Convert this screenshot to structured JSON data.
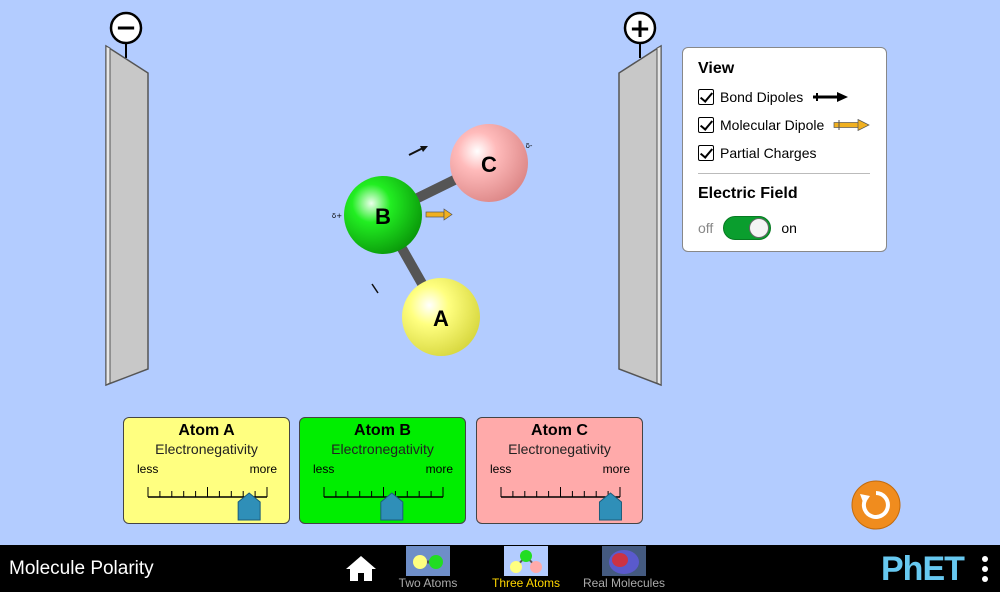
{
  "app": {
    "title": "Molecule Polarity"
  },
  "plates": {
    "negative_symbol": "−",
    "positive_symbol": "+"
  },
  "molecule": {
    "atoms": [
      {
        "label": "A",
        "color": "#ffff80"
      },
      {
        "label": "B",
        "color": "#22dd22"
      },
      {
        "label": "C",
        "color": "#ffaaaa"
      }
    ],
    "partial_charge_b": "δ+",
    "partial_charge_c": "δ-"
  },
  "view_panel": {
    "title": "View",
    "options": [
      {
        "label": "Bond Dipoles",
        "checked": true
      },
      {
        "label": "Molecular Dipole",
        "checked": true
      },
      {
        "label": "Partial Charges",
        "checked": true
      }
    ],
    "electric_field": {
      "title": "Electric Field",
      "off_label": "off",
      "on_label": "on",
      "state": "on"
    }
  },
  "atom_panels": [
    {
      "title": "Atom A",
      "subtitle": "Electronegativity",
      "less": "less",
      "more": "more",
      "bg": "#ffff80",
      "value_fraction": 0.85
    },
    {
      "title": "Atom B",
      "subtitle": "Electronegativity",
      "less": "less",
      "more": "more",
      "bg": "#00ee00",
      "value_fraction": 0.57
    },
    {
      "title": "Atom C",
      "subtitle": "Electronegativity",
      "less": "less",
      "more": "more",
      "bg": "#ffaaaa",
      "value_fraction": 0.92
    }
  ],
  "navbar": {
    "tabs": [
      {
        "label": "Two Atoms",
        "active": false
      },
      {
        "label": "Three Atoms",
        "active": true
      },
      {
        "label": "Real Molecules",
        "active": false
      }
    ],
    "brand": "PhET"
  },
  "colors": {
    "background": "#b3ccff",
    "active_tab": "#ffd700",
    "reset": "#f08c1e",
    "toggle_on": "#0a9e2e"
  }
}
